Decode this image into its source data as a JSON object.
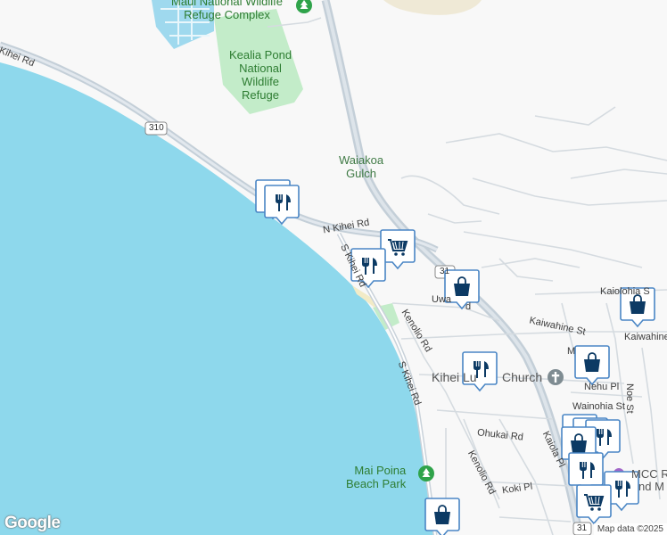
{
  "map": {
    "labels": {
      "refuge_complex_l1": "Maui National Wildlife",
      "refuge_complex_l2": "Refuge Complex",
      "kealia_l1": "Kealia Pond",
      "kealia_l2": "National",
      "kealia_l3": "Wildlife",
      "kealia_l4": "Refuge",
      "gulch_l1": "Waiakoa",
      "gulch_l2": "Gulch",
      "n_kihei_rd_west": "Kihei Rd",
      "n_kihei_rd": "N Kihei Rd",
      "s_kihei_rd_north": "S Kihei Rd",
      "s_kihei_rd_south": "S Kihei Rd",
      "kenolio_rd_north": "Kenolio Rd",
      "kenolio_rd_south": "Kenolio Rd",
      "uwapo_rd": "Uwa",
      "uwapo_rd_end": "d",
      "kaiolohia_st": "Kaiolohia S",
      "kaiwahine_st_w": "Kaiwahine St",
      "kaiwahine_st_e": "Kaiwahine",
      "nehu_pl": "Nehu Pl",
      "noe_st": "Noe St",
      "wainohia_st": "Wainohia St",
      "ohukai_rd": "Ohukai Rd",
      "kaiola_pl": "Kaiola Pl",
      "koki_pl": "Koki Pl",
      "church_part1": "Kihei Lu",
      "church_part2": "Church",
      "beach_park_l1": "Mai Poina",
      "beach_park_l2": "Beach Park",
      "mcc_l1": "MCC R",
      "mcc_l2": "nd M",
      "route_310": "310",
      "route_31_a": "31",
      "route_31_b": "31",
      "m_partial": "M"
    },
    "colors": {
      "water": "#8ed8ec",
      "land": "#f8f8f8",
      "park": "#c3ecc9",
      "road": "#c4cfd8",
      "pin_fill": "#ffffff",
      "pin_border": "#3f7fbf",
      "pin_icon": "#0c3a64"
    },
    "markers": [
      {
        "type": "restaurant",
        "icon": "fork-knife-icon"
      },
      {
        "type": "restaurant",
        "icon": "fork-knife-icon"
      },
      {
        "type": "grocery",
        "icon": "shopping-cart-icon"
      },
      {
        "type": "restaurant",
        "icon": "fork-knife-icon"
      },
      {
        "type": "shopping",
        "icon": "shopping-bag-icon"
      },
      {
        "type": "shopping",
        "icon": "shopping-bag-icon"
      },
      {
        "type": "restaurant",
        "icon": "fork-knife-icon"
      },
      {
        "type": "shopping",
        "icon": "shopping-bag-icon"
      },
      {
        "type": "shopping",
        "icon": "shopping-bag-icon"
      },
      {
        "type": "shopping",
        "icon": "shopping-bag-icon"
      },
      {
        "type": "restaurant",
        "icon": "fork-knife-icon"
      },
      {
        "type": "restaurant",
        "icon": "fork-knife-icon"
      },
      {
        "type": "restaurant",
        "icon": "fork-knife-icon"
      },
      {
        "type": "grocery",
        "icon": "shopping-cart-icon"
      },
      {
        "type": "shopping",
        "icon": "shopping-bag-icon"
      }
    ]
  },
  "footer": {
    "logo": "Google",
    "attribution": "Map data ©2025"
  }
}
